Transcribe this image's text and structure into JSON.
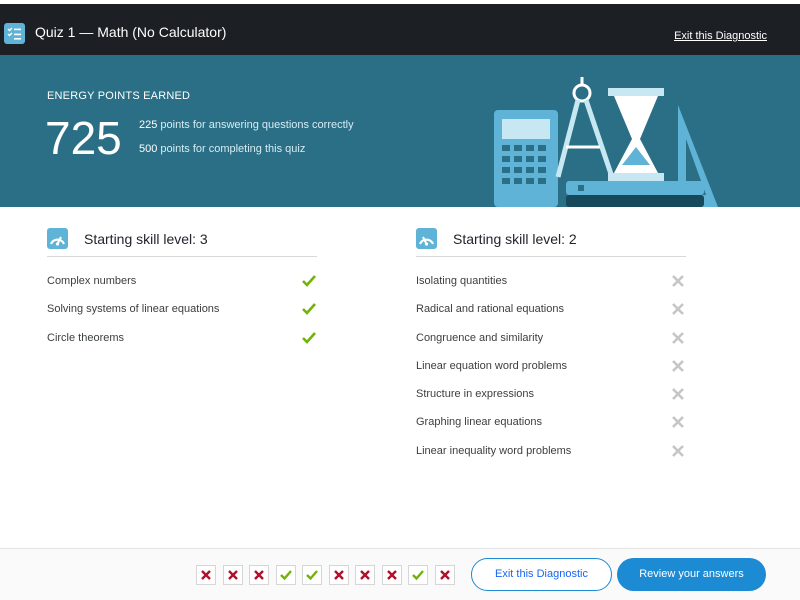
{
  "header": {
    "quiz_title": "Quiz 1 — Math (No Calculator)",
    "exit_link": "Exit this Diagnostic",
    "icon": "checklist-icon"
  },
  "energy": {
    "label": "ENERGY POINTS EARNED",
    "total": "725",
    "breakdown": [
      {
        "points": "225",
        "text": " points for answering questions correctly"
      },
      {
        "points": "500",
        "text": " points for completing this quiz"
      }
    ]
  },
  "skill_groups": [
    {
      "title": "Starting skill level: 3",
      "icon": "gauge-icon",
      "skills": [
        {
          "name": "Complex numbers",
          "status": "correct"
        },
        {
          "name": "Solving systems of linear equations",
          "status": "correct"
        },
        {
          "name": "Circle theorems",
          "status": "correct"
        }
      ]
    },
    {
      "title": "Starting skill level: 2",
      "icon": "gauge-icon",
      "skills": [
        {
          "name": "Isolating quantities",
          "status": "incorrect"
        },
        {
          "name": "Radical and rational equations",
          "status": "incorrect"
        },
        {
          "name": "Congruence and similarity",
          "status": "incorrect"
        },
        {
          "name": "Linear equation word problems",
          "status": "incorrect"
        },
        {
          "name": "Structure in expressions",
          "status": "incorrect"
        },
        {
          "name": "Graphing linear equations",
          "status": "incorrect"
        },
        {
          "name": "Linear inequality word problems",
          "status": "incorrect"
        }
      ]
    }
  ],
  "answer_results": [
    "incorrect",
    "incorrect",
    "incorrect",
    "correct",
    "correct",
    "incorrect",
    "incorrect",
    "incorrect",
    "correct",
    "incorrect"
  ],
  "footer": {
    "exit_button": "Exit this Diagnostic",
    "review_button": "Review your answers"
  },
  "colors": {
    "header_bg": "#1c1f24",
    "banner_bg": "#2a6f86",
    "accent_blue": "#1c8bd4",
    "correct_green": "#71b307",
    "incorrect_red": "#b0102a",
    "incorrect_gray": "#c6c6c6"
  }
}
